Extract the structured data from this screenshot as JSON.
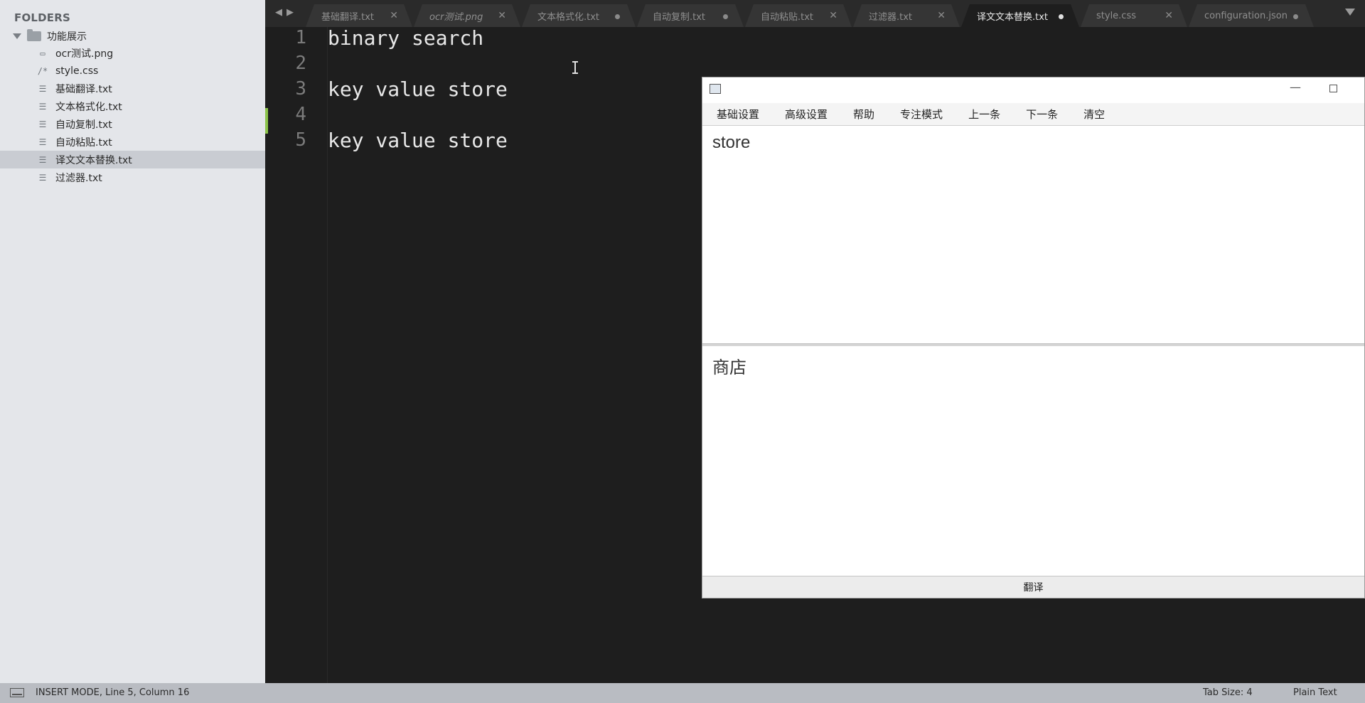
{
  "sidebar": {
    "header": "FOLDERS",
    "root_folder": "功能展示",
    "files": [
      {
        "name": "ocr测试.png",
        "icon": "image-icon"
      },
      {
        "name": "style.css",
        "icon": "css-icon"
      },
      {
        "name": "基础翻译.txt",
        "icon": "text-file-icon"
      },
      {
        "name": "文本格式化.txt",
        "icon": "text-file-icon"
      },
      {
        "name": "自动复制.txt",
        "icon": "text-file-icon"
      },
      {
        "name": "自动粘贴.txt",
        "icon": "text-file-icon"
      },
      {
        "name": "译文文本替换.txt",
        "icon": "text-file-icon",
        "active": true
      },
      {
        "name": "过滤器.txt",
        "icon": "text-file-icon"
      }
    ]
  },
  "tabs": [
    {
      "label": "基础翻译.txt",
      "state": "close"
    },
    {
      "label": "ocr测试.png",
      "state": "close",
      "italic": true
    },
    {
      "label": "文本格式化.txt",
      "state": "dirty"
    },
    {
      "label": "自动复制.txt",
      "state": "dirty"
    },
    {
      "label": "自动粘贴.txt",
      "state": "close"
    },
    {
      "label": "过滤器.txt",
      "state": "close"
    },
    {
      "label": "译文文本替换.txt",
      "state": "dirty",
      "active": true
    },
    {
      "label": "style.css",
      "state": "close"
    },
    {
      "label": "configuration.json",
      "state": "dirty"
    }
  ],
  "editor": {
    "lines": [
      {
        "num": "1",
        "text": "binary search"
      },
      {
        "num": "2",
        "text": ""
      },
      {
        "num": "3",
        "text": "key value store"
      },
      {
        "num": "4",
        "text": ""
      },
      {
        "num": "5",
        "text": "key value store"
      }
    ]
  },
  "popup": {
    "menu": [
      "基础设置",
      "高级设置",
      "帮助",
      "专注模式",
      "上一条",
      "下一条",
      "清空"
    ],
    "source_text": "store",
    "target_text": "商店",
    "translate_button": "翻译"
  },
  "statusbar": {
    "mode": "INSERT MODE, Line 5, Column 16",
    "tab_size": "Tab Size: 4",
    "syntax": "Plain Text"
  },
  "colors": {
    "sidebar_bg": "#e4e6ea",
    "editor_bg": "#1e1e1e",
    "modified_marker": "#8bc34a",
    "statusbar_bg": "#b9bcc2"
  }
}
